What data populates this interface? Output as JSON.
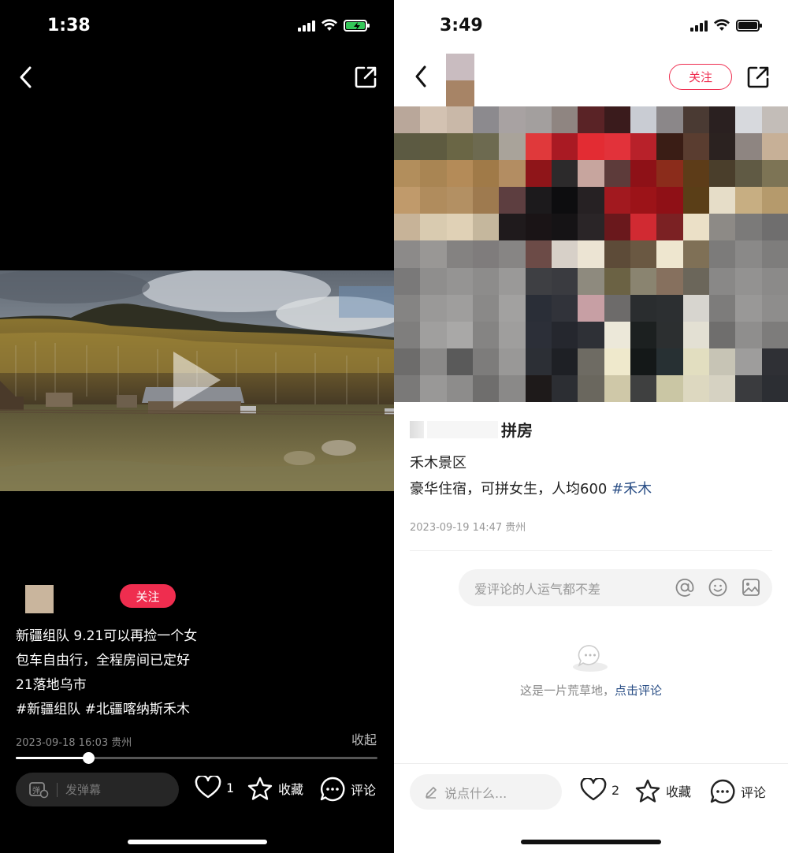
{
  "left": {
    "status": {
      "time": "1:38"
    },
    "author": {
      "follow_label": "关注"
    },
    "caption": {
      "line1": "新疆组队 9.21可以再捡一个女",
      "line2": "包车自由行，全程房间已定好",
      "line3": "21落地乌市",
      "line4": "#新疆组队  #北疆喀纳斯禾木"
    },
    "post_date": "2023-09-18 16:03 贵州",
    "collapse_label": "收起",
    "progress": 0.2,
    "danmaku_placeholder": "发弹幕",
    "actions": {
      "like_count": "1",
      "collect_label": "收藏",
      "comment_label": "评论"
    }
  },
  "right": {
    "status": {
      "time": "3:49"
    },
    "follow_label": "关注",
    "title_visible": "拼房",
    "subtitle": "禾木景区",
    "body": "豪华住宿，可拼女生，人均600 ",
    "body_tag": "#禾木",
    "post_date": "2023-09-19 14:47 贵州",
    "comment_placeholder": "爱评论的人运气都不差",
    "empty_text": "这是一片荒草地，",
    "empty_link": "点击评论",
    "say_placeholder": "说点什么...",
    "actions": {
      "like_count": "2",
      "collect_label": "收藏",
      "comment_label": "评论"
    }
  },
  "colors": {
    "accent_red": "#ef2d4f",
    "battery_green": "#34c759",
    "link_blue": "#2b4f86"
  },
  "mosaic_colors": [
    [
      "#b9a79a",
      "#d3c2b2",
      "#c9b8a8",
      "#8c8a8e",
      "#a8a2a2",
      "#a39f9e",
      "#8f8581",
      "#5a2326",
      "#3a1b1c",
      "#c9ccd3",
      "#8b8789",
      "#4a3a33",
      "#2a2020",
      "#d7d9dd",
      "#c3bdb8"
    ],
    [
      "#5c5a42",
      "#5e5b40",
      "#6a6645",
      "#6d6a50",
      "#a9a39a",
      "#e0393b",
      "#a91a23",
      "#e32c33",
      "#e2323a",
      "#b8212a",
      "#3a1d15",
      "#5a3d30",
      "#2b2220",
      "#8e8581",
      "#c7b097"
    ],
    [
      "#b28e5c",
      "#a98553",
      "#b48b58",
      "#a07a48",
      "#b38d62",
      "#8f1519",
      "#2c2a2b",
      "#c7a59e",
      "#5d3b3a",
      "#8e1117",
      "#8b2c1b",
      "#5d3c18",
      "#4a3e2b",
      "#605a44",
      "#7d7455"
    ],
    [
      "#c09a6b",
      "#b08c5d",
      "#b39063",
      "#9e7a4f",
      "#5d3e40",
      "#1c1a1c",
      "#0d0d0f",
      "#262123",
      "#a2191f",
      "#9c1318",
      "#8f1016",
      "#5a3e17",
      "#e6ddc8",
      "#c7ae82",
      "#b59a6c"
    ],
    [
      "#c7b398",
      "#d9cbb0",
      "#e0d1b6",
      "#c5b79d",
      "#1f1a1c",
      "#1a1416",
      "#151315",
      "#2a2527",
      "#6a181c",
      "#d12a32",
      "#7b2123",
      "#ebe0c7",
      "#8d8a86",
      "#7b7a79",
      "#6f6e6e"
    ],
    [
      "#8c8a89",
      "#999795",
      "#848281",
      "#7f7c7c",
      "#878584",
      "#6c4b47",
      "#d7d0c8",
      "#ece4d3",
      "#5d4b38",
      "#6a5842",
      "#eee6cf",
      "#7f7056",
      "#7c7b7a",
      "#8a8988",
      "#7e7d7c"
    ],
    [
      "#7a7979",
      "#8f8e8d",
      "#959493",
      "#8d8c8b",
      "#9a9998",
      "#3e3f43",
      "#3a3b40",
      "#8e8a7e",
      "#6b6244",
      "#8a8470",
      "#86705e",
      "#6b665a",
      "#898887",
      "#939291",
      "#8b8a89"
    ],
    [
      "#858483",
      "#9a9998",
      "#9f9e9d",
      "#8a8988",
      "#a2a1a0",
      "#2a2e37",
      "#31333a",
      "#c79fa4",
      "#6d6b6a",
      "#2a2d2f",
      "#2c2f31",
      "#d7d5cf",
      "#7d7c7b",
      "#999897",
      "#8e8d8c"
    ],
    [
      "#7f7e7d",
      "#a09f9e",
      "#a9a8a7",
      "#858483",
      "#9f9e9d",
      "#2c2f38",
      "#25272e",
      "#2e3036",
      "#ece8d9",
      "#1c2020",
      "#2c2f30",
      "#e3e0d3",
      "#6f6e6d",
      "#8f8e8d",
      "#7d7c7b"
    ],
    [
      "#6d6c6b",
      "#8a8988",
      "#5a5a5a",
      "#7d7c7b",
      "#999897",
      "#2c2f35",
      "#1e2025",
      "#6e6b63",
      "#efe9cc",
      "#141818",
      "#273033",
      "#e2dec0",
      "#c7c4b5",
      "#9e9d9c",
      "#2f3035"
    ],
    [
      "#7a7978",
      "#999897",
      "#8d8c8b",
      "#6f6e6d",
      "#8a8988",
      "#1e1a1a",
      "#2c2e33",
      "#6a675e",
      "#cfc8a8",
      "#3f4040",
      "#cac6a4",
      "#ddd8c0",
      "#d6d2c2",
      "#3a3b3e",
      "#2c2e33"
    ]
  ]
}
